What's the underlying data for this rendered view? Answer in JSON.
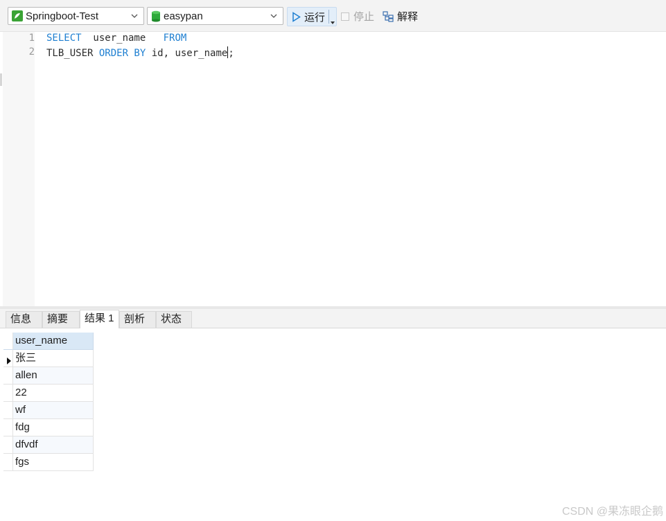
{
  "toolbar": {
    "connection": "Springboot-Test",
    "database": "easypan",
    "run_label": "运行",
    "stop_label": "停止",
    "explain_label": "解释",
    "connection_icon": "connection-icon",
    "database_icon": "database-icon"
  },
  "editor": {
    "line_numbers": [
      "1",
      "2"
    ],
    "line1": {
      "kw1": "SELECT",
      "mid": "  user_name   ",
      "kw2": "FROM"
    },
    "line2": {
      "table": "TLB_USER ",
      "kw": "ORDER BY",
      "rest_before": " id, user_name",
      "rest_after": ";"
    }
  },
  "tabs": [
    "信息",
    "摘要",
    "结果 1",
    "剖析",
    "状态"
  ],
  "active_tab": "结果 1",
  "result": {
    "column": "user_name",
    "rows": [
      "张三",
      "allen",
      "22",
      "wf",
      "fdg",
      "dfvdf",
      "fgs"
    ],
    "current_row": 0
  },
  "watermark": "CSDN @果冻眼企鹅",
  "colors": {
    "keyword": "#1e7fd1",
    "accent": "#d9e8f6",
    "run_bg": "#e3eef9"
  }
}
